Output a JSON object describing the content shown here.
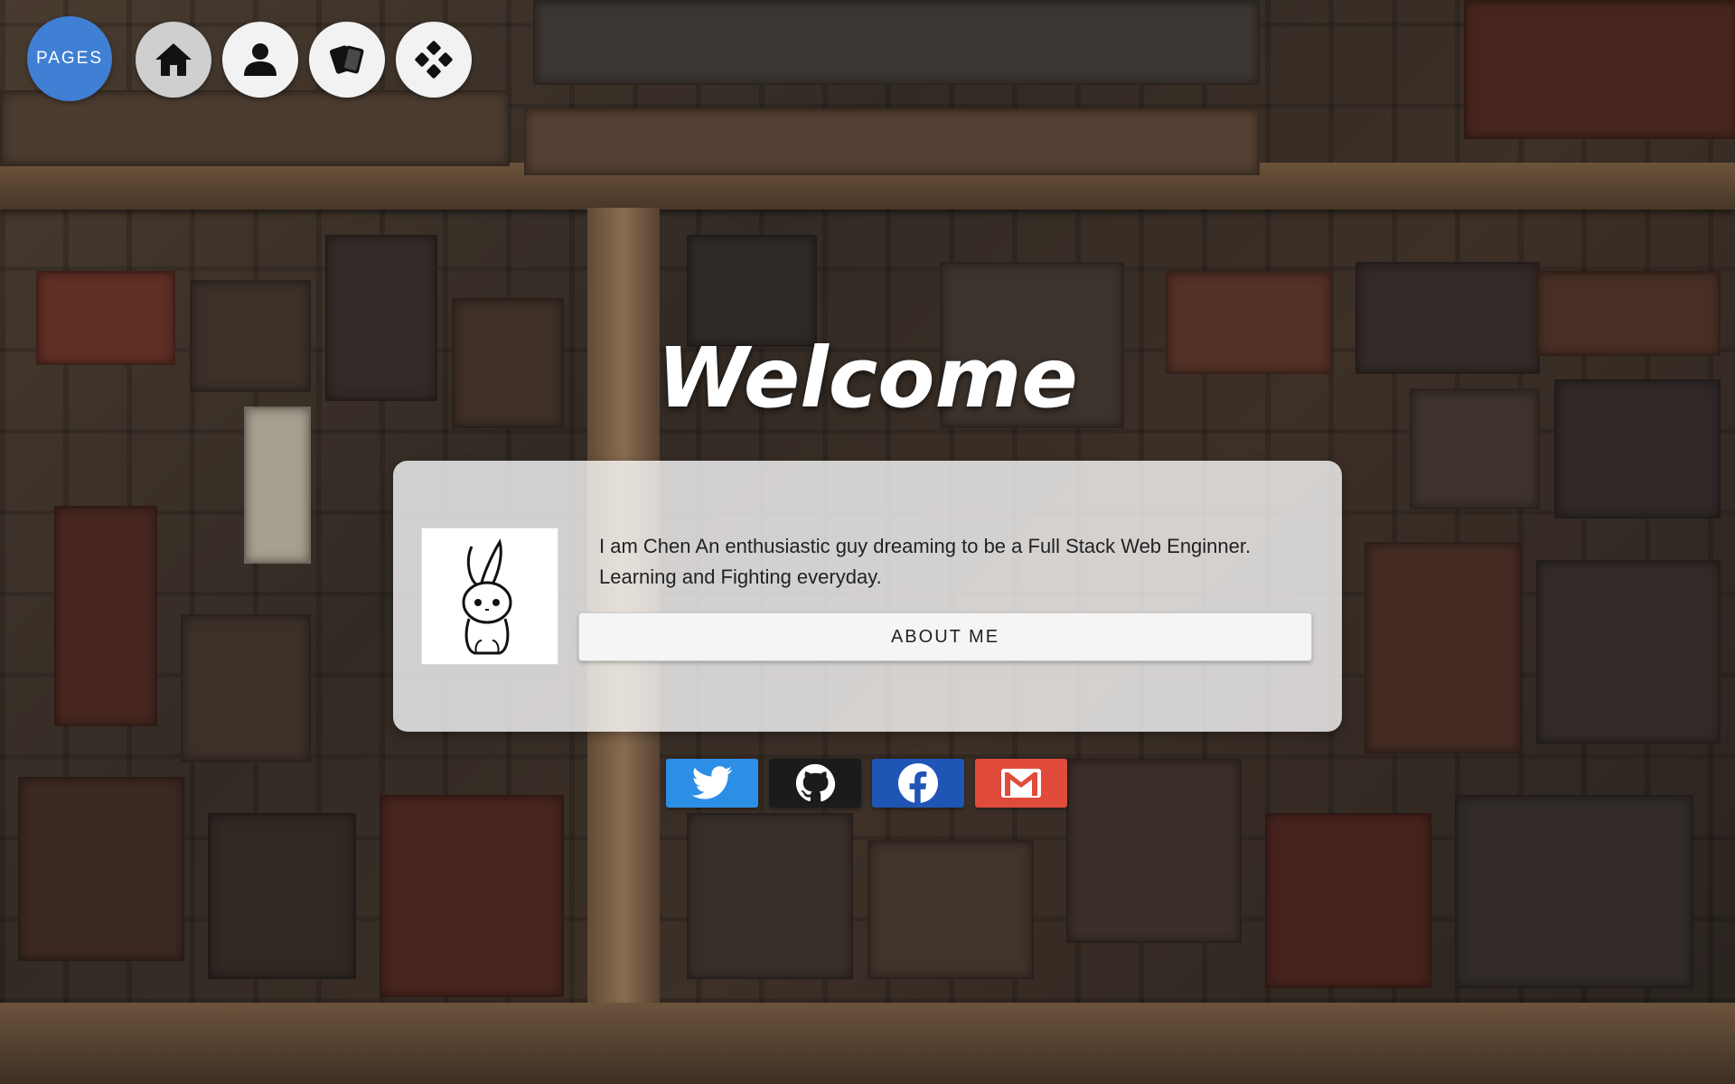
{
  "nav": {
    "pages_label": "PAGES",
    "items": [
      {
        "icon": "home-icon"
      },
      {
        "icon": "user-icon"
      },
      {
        "icon": "cards-icon"
      },
      {
        "icon": "gamepad-icon"
      }
    ]
  },
  "hero": {
    "title": "Welcome"
  },
  "profile": {
    "bio": "I am Chen An enthusiastic guy dreaming to be a Full Stack Web Enginner. Learning and Fighting everyday.",
    "about_label": "ABOUT ME",
    "avatar_icon": "rabbit-avatar-icon"
  },
  "social": [
    {
      "name": "twitter",
      "icon": "twitter-icon",
      "color": "#2d8ee6"
    },
    {
      "name": "github",
      "icon": "github-icon",
      "color": "#1b1b1b"
    },
    {
      "name": "facebook",
      "icon": "facebook-icon",
      "color": "#1f55b5"
    },
    {
      "name": "gmail",
      "icon": "gmail-icon",
      "color": "#e04b3b"
    }
  ],
  "colors": {
    "accent": "#3f7fd4"
  }
}
